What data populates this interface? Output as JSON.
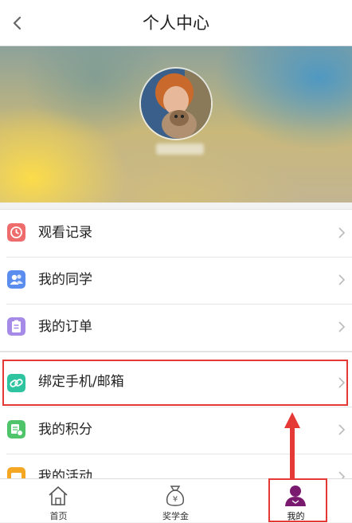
{
  "header": {
    "title": "个人中心",
    "back_icon": "chevron-left-icon"
  },
  "profile": {
    "avatar_icon": "user-avatar"
  },
  "menu": {
    "group1": [
      {
        "label": "观看记录",
        "icon": "clock-icon",
        "color": "#ef6c6c"
      },
      {
        "label": "我的同学",
        "icon": "classmates-icon",
        "color": "#5b8def"
      },
      {
        "label": "我的订单",
        "icon": "order-icon",
        "color": "#a58ae8"
      }
    ],
    "group2": [
      {
        "label": "绑定手机/邮箱",
        "icon": "link-icon",
        "color": "#2ec4a0"
      },
      {
        "label": "我的积分",
        "icon": "points-icon",
        "color": "#4fc46b"
      },
      {
        "label": "我的活动",
        "icon": "activity-icon",
        "color": "#f5a623"
      }
    ]
  },
  "tabbar": {
    "tabs": [
      {
        "label": "首页",
        "icon": "home-icon"
      },
      {
        "label": "奖学金",
        "icon": "money-bag-icon"
      },
      {
        "label": "我的",
        "icon": "user-icon"
      }
    ],
    "active_color": "#7a1a6e"
  },
  "annotation": {
    "highlight_color": "#e53935"
  }
}
